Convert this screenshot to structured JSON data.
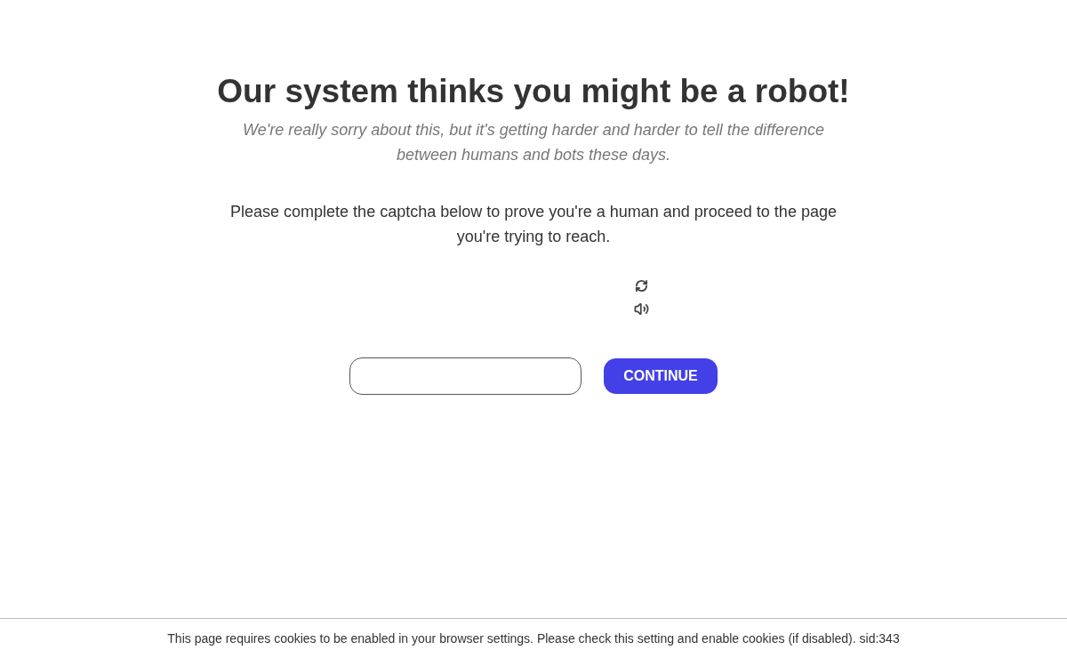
{
  "heading": "Our system thinks you might be a robot!",
  "subtitle": "We're really sorry about this, but it's getting harder and harder to tell the difference between humans and bots these days.",
  "instructions": "Please complete the captcha below to prove you're a human and proceed to the page you're trying to reach.",
  "captcha": {
    "button": "CONTINUE"
  },
  "footer": "This page requires cookies to be enabled in your browser settings. Please check this setting and enable cookies (if disabled). sid:343"
}
